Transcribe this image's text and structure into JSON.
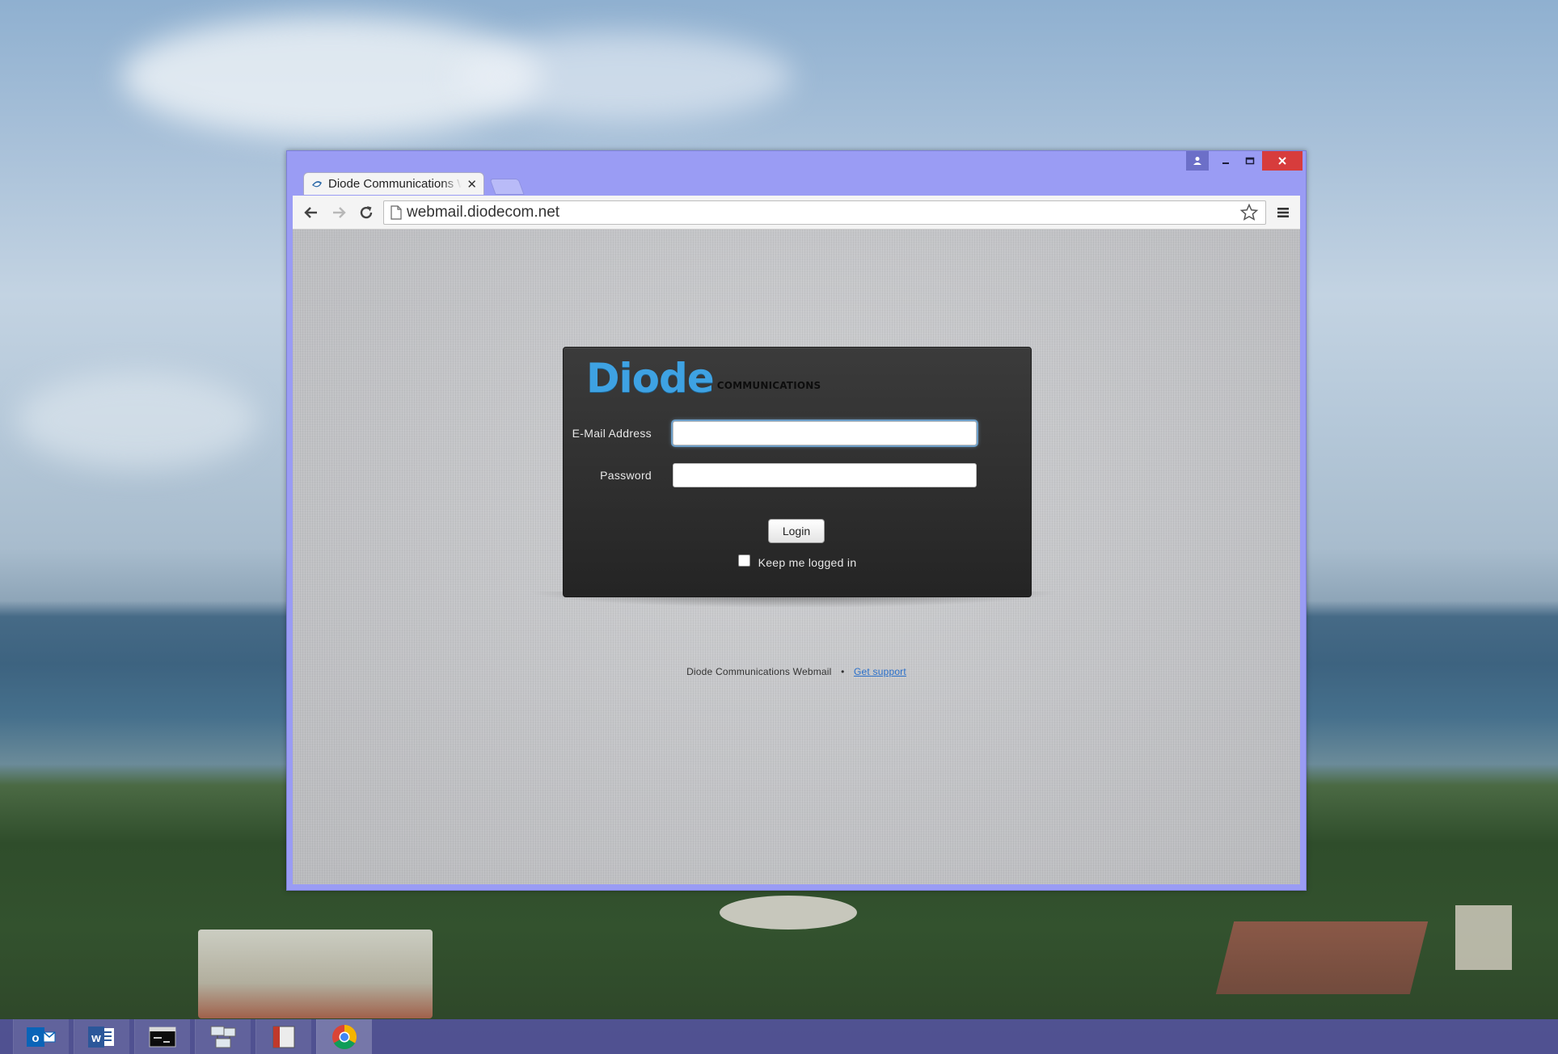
{
  "browser": {
    "tab_title": "Diode Communications W",
    "url": "webmail.diodecom.net",
    "window_controls": {
      "profile": "person-icon",
      "minimize": "minimize-icon",
      "maximize": "maximize-icon",
      "close": "close-icon"
    }
  },
  "login": {
    "logo_main": "Diode",
    "logo_sub": "COMMUNICATIONS",
    "email_label": "E-Mail Address",
    "email_value": "",
    "password_label": "Password",
    "password_value": "",
    "login_button": "Login",
    "remember_label": "Keep me logged in",
    "remember_checked": false
  },
  "footer": {
    "text": "Diode Communications Webmail",
    "separator": "•",
    "link": "Get support"
  },
  "taskbar": {
    "items": [
      {
        "name": "Outlook",
        "icon": "outlook-icon"
      },
      {
        "name": "Word",
        "icon": "word-icon"
      },
      {
        "name": "Command Prompt",
        "icon": "terminal-icon"
      },
      {
        "name": "Network",
        "icon": "network-icon"
      },
      {
        "name": "Reader",
        "icon": "reader-icon"
      },
      {
        "name": "Chrome",
        "icon": "chrome-icon"
      }
    ]
  },
  "colors": {
    "window_frame": "#9a9cf4",
    "close_button": "#d73c3c",
    "logo_blue": "#3ea2e3",
    "link_blue": "#2a6fc9",
    "taskbar": "#5854a8"
  }
}
